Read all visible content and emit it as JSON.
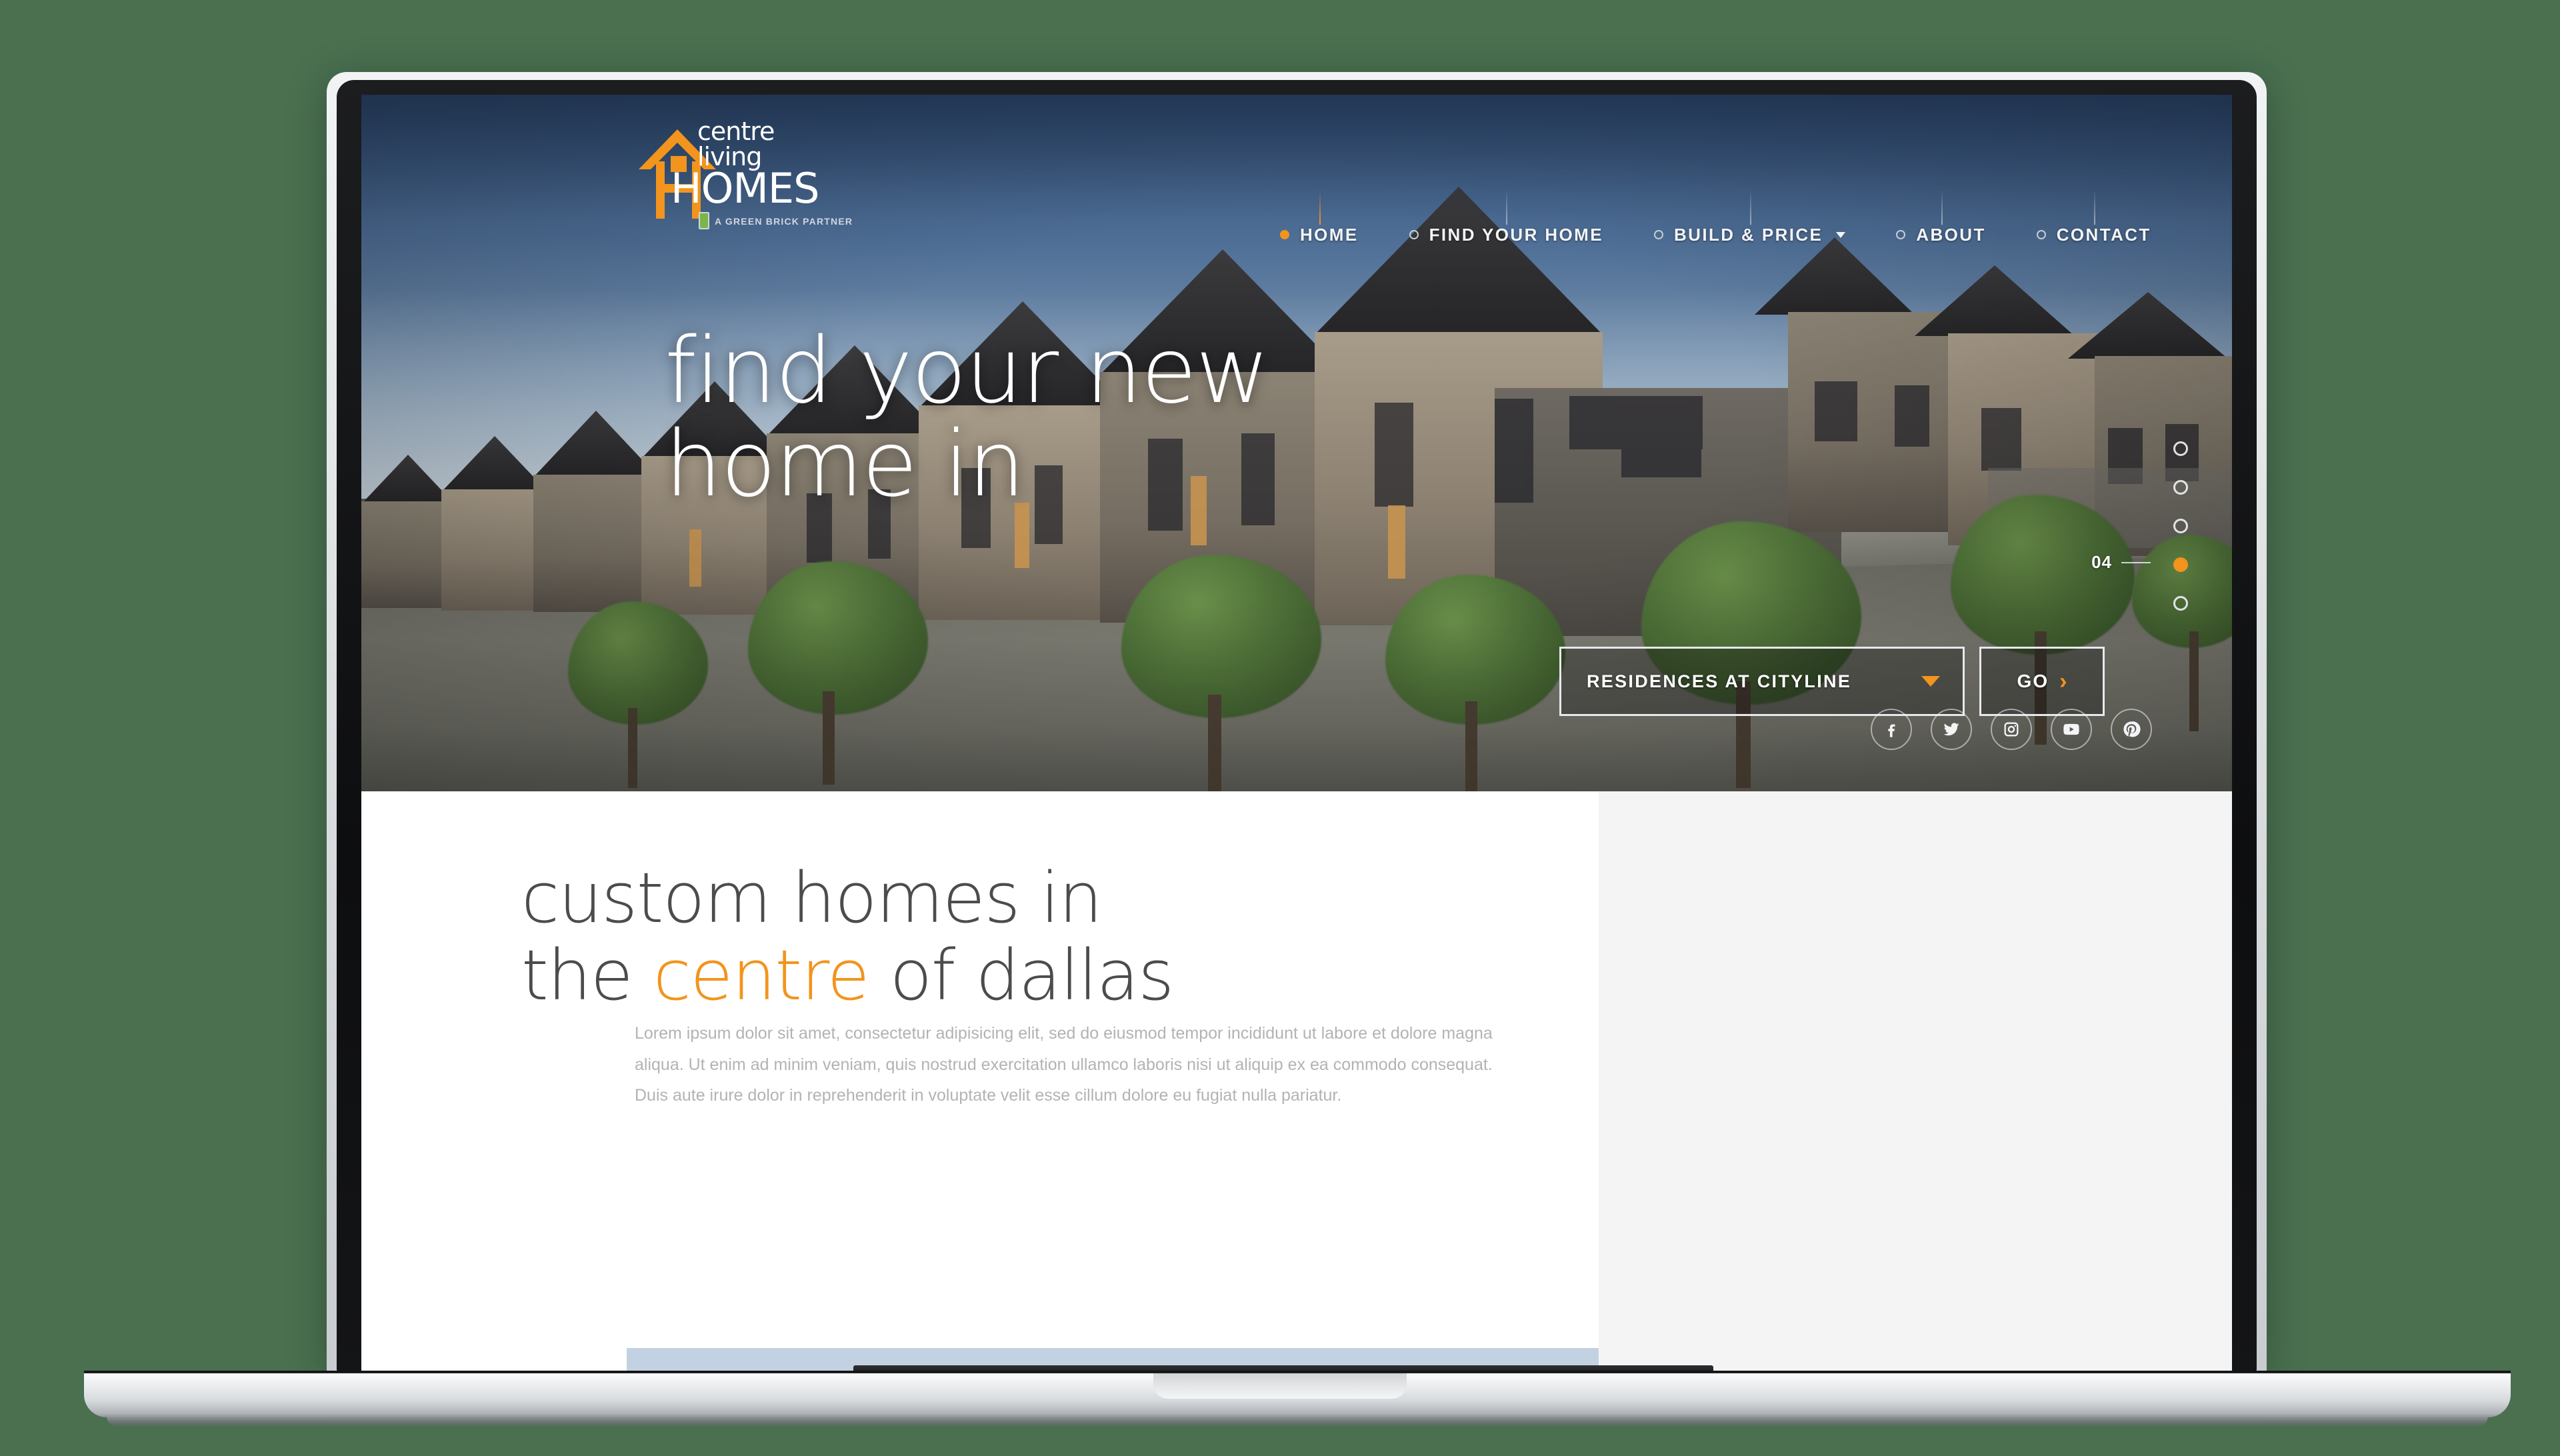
{
  "site": {
    "brand": {
      "logo_line1": "centre",
      "logo_line2": "living",
      "logo_wordmark": "HOMES",
      "tagline": "A GREEN BRICK PARTNER",
      "accent_color": "#f2941d",
      "logo_icon": "house-outline-icon"
    },
    "nav": {
      "items": [
        {
          "label": "HOME",
          "active": true,
          "has_dropdown": false
        },
        {
          "label": "FIND YOUR HOME",
          "active": false,
          "has_dropdown": false
        },
        {
          "label": "BUILD & PRICE",
          "active": false,
          "has_dropdown": true
        },
        {
          "label": "ABOUT",
          "active": false,
          "has_dropdown": false
        },
        {
          "label": "CONTACT",
          "active": false,
          "has_dropdown": false
        }
      ]
    }
  },
  "hero": {
    "headline_line1": "find your new",
    "headline_line2": "home in",
    "search": {
      "select_value": "RESIDENCES AT CITYLINE",
      "select_icon": "chevron-down-icon",
      "go_label": "GO",
      "go_icon": "chevron-right-icon"
    },
    "slider": {
      "total_dots": 5,
      "active_index": 3,
      "counter": "04"
    },
    "social": [
      {
        "name": "facebook",
        "icon": "facebook-icon"
      },
      {
        "name": "twitter",
        "icon": "twitter-icon"
      },
      {
        "name": "instagram",
        "icon": "instagram-icon"
      },
      {
        "name": "youtube",
        "icon": "youtube-icon"
      },
      {
        "name": "pinterest",
        "icon": "pinterest-icon"
      }
    ]
  },
  "content": {
    "heading_part1": "custom homes in",
    "heading_part2": "the ",
    "heading_accent": "centre",
    "heading_part3": " of dallas",
    "paragraph": "Lorem ipsum dolor sit amet, consectetur adipisicing elit, sed do eiusmod tempor incididunt ut labore et dolore magna aliqua. Ut enim ad minim veniam, quis nostrud exercitation ullamco laboris nisi ut aliquip ex ea commodo consequat. Duis aute irure dolor in reprehenderit in voluptate velit esse cillum dolore eu fugiat nulla pariatur."
  }
}
